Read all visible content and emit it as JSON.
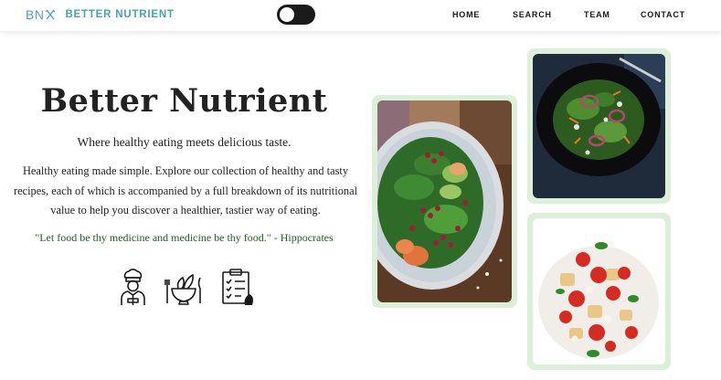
{
  "brand": {
    "mark": "BN",
    "name": "BETTER NUTRIENT"
  },
  "nav": {
    "items": [
      "HOME",
      "SEARCH",
      "TEAM",
      "CONTACT"
    ]
  },
  "theme_toggle": {
    "state": "dark"
  },
  "hero": {
    "title": "Better Nutrient",
    "subtitle": "Where healthy eating meets delicious taste.",
    "description": "Healthy eating made simple. Explore our collection of healthy and tasty recipes, each of which is accompanied by a full breakdown of its nutritional value to help you discover a healthier, tastier way of eating.",
    "quote": "\"Let food be thy medicine and medicine be thy food.\" - Hippocrates",
    "icons": [
      "chef-icon",
      "salad-bowl-icon",
      "nutrition-checklist-icon"
    ]
  },
  "gallery": {
    "photos": [
      "spinach-pomegranate-salad",
      "dark-bowl-salad",
      "tomato-bread-salad"
    ]
  },
  "colors": {
    "brand": "#45a3ad",
    "card_frame": "#dcefd9",
    "quote": "#1f5e2a",
    "toggle": "#1b1b1b"
  }
}
